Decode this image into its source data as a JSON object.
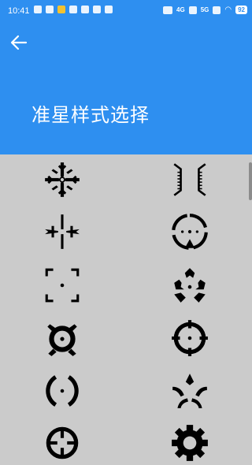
{
  "status_bar": {
    "time": "10:41",
    "network_left": "4G",
    "network_right": "5G",
    "battery": "92"
  },
  "header": {
    "title": "准星样式选择",
    "background": "#2e8ff0"
  },
  "crosshair_styles": [
    {
      "id": "snowflake-crosshair-icon"
    },
    {
      "id": "bracket-crosshair-icon"
    },
    {
      "id": "winged-cross-crosshair-icon"
    },
    {
      "id": "circle-triangle-crosshair-icon"
    },
    {
      "id": "corner-brackets-crosshair-icon"
    },
    {
      "id": "tri-blade-crosshair-icon"
    },
    {
      "id": "turtle-crosshair-icon"
    },
    {
      "id": "ring-ticks-crosshair-icon"
    },
    {
      "id": "parentheses-crosshair-icon"
    },
    {
      "id": "four-arcs-crosshair-icon"
    },
    {
      "id": "scope-ring-crosshair-icon"
    },
    {
      "id": "gear-crosshair-icon"
    }
  ]
}
